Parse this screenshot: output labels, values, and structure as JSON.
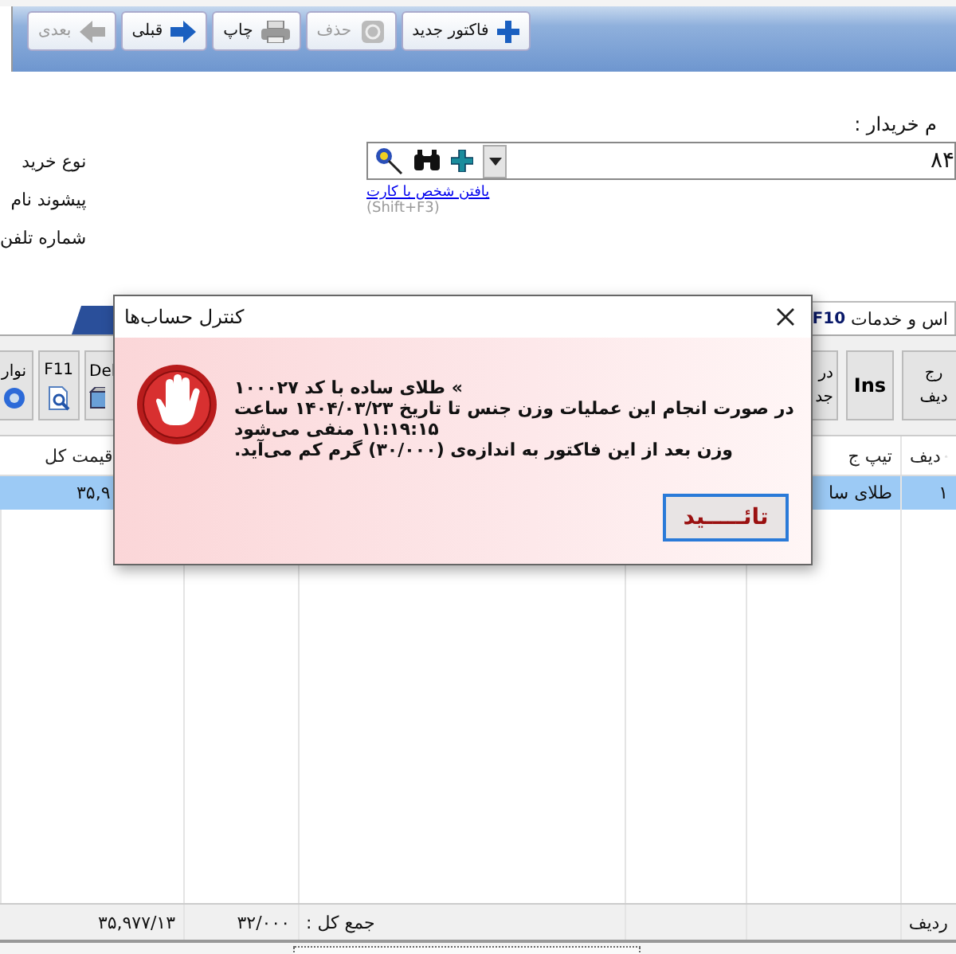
{
  "toolbar": [
    {
      "label": "فاکتور جدید",
      "kind": "plus",
      "disabled": false
    },
    {
      "label": "حذف",
      "kind": "eraser",
      "disabled": true
    },
    {
      "label": "چاپ",
      "kind": "printer",
      "disabled": false
    },
    {
      "label": "قبلی",
      "kind": "arrow-right",
      "disabled": false
    },
    {
      "label": "بعدی",
      "kind": "arrow-left",
      "disabled": true
    }
  ],
  "buyer": {
    "label": "م خریدار :",
    "value": "۸۴",
    "link": "یافتن شخص با کارت",
    "shortcut": "(Shift+F3)"
  },
  "side_labels": [
    "نوع خرید",
    "پیشوند نام",
    "شماره تلفن"
  ],
  "tabs": [
    {
      "label": "اس و خدمات",
      "key": "F10",
      "selected": true
    }
  ],
  "left_buttons": [
    {
      "lines": [
        "Del"
      ],
      "kind": "cube"
    },
    {
      "lines": [
        "F11"
      ],
      "kind": "doc-search"
    },
    {
      "lines": [
        "نوار"
      ],
      "kind": "help"
    }
  ],
  "right_buttons": [
    {
      "lines": [
        "رج",
        "دیف"
      ]
    },
    {
      "lines": [
        "Ins"
      ]
    },
    {
      "lines": [
        "در",
        "جد"
      ]
    }
  ],
  "table": {
    "columns": [
      {
        "label": "دیف",
        "sorted": true
      },
      {
        "label": "تیپ ج"
      },
      {
        "label": "قیمت کل"
      }
    ],
    "rows": [
      {
        "selected": true,
        "cells": [
          "۱",
          "طلای سا",
          "۳۵,۹"
        ]
      }
    ],
    "footer": {
      "row_label": "ردیف",
      "total_label": "جمع کل :",
      "total_weight": "۳۲/۰۰۰",
      "total_price": "۳۵,۹۷۷/۱۳"
    }
  },
  "dialog": {
    "title": "کنترل حساب‌ها",
    "lines": [
      "» طلای ساده با کد ۱۰۰۰۲۷",
      "در صورت انجام این عملیات وزن جنس تا تاریخ ۱۴۰۴/۰۳/۲۳ ساعت",
      "۱۱:۱۹:۱۵ منفی می‌شود",
      "وزن بعد از این فاکتور به اندازه‌ی (۳۰/۰۰۰) گرم کم می‌آید."
    ],
    "button": "تائـــــید"
  }
}
